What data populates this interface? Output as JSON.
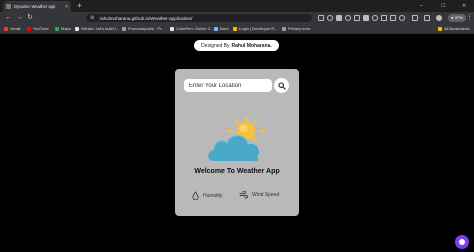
{
  "browser": {
    "tab_title": "Dynamic Weather app",
    "tab_close": "×",
    "new_tab": "+",
    "url": "rahulmoharana.github.io/Weather-application/",
    "profile_label": "● VPN",
    "window_controls": {
      "minimize": "–",
      "maximize": "☐",
      "close": "✕"
    },
    "menu": "⋮",
    "bookmarks": [
      {
        "label": "Gmail",
        "color": "#ea4335"
      },
      {
        "label": "YouTube",
        "color": "#ff0000"
      },
      {
        "label": "Maps",
        "color": "#34a853"
      },
      {
        "label": "GitHub: Let's build f...",
        "color": "#e6e6e6"
      },
      {
        "label": "Promonepubls · Pr...",
        "color": "#9aa0a6"
      },
      {
        "label": "CodePen: Online C...",
        "color": "#e6e6e6"
      },
      {
        "label": "Bard",
        "color": "#8ab4f8"
      },
      {
        "label": "Login | Developer R...",
        "color": "#fbbc04"
      },
      {
        "label": "Privacy error",
        "color": "#9aa0a6"
      }
    ],
    "all_bookmarks": "All Bookmarks"
  },
  "credit": {
    "prefix": "Designed By",
    "name": "Rahul Moharana."
  },
  "weather": {
    "search_placeholder": "Enter Your Location",
    "search_value": "",
    "welcome": "Welcome To Weather App",
    "humidity_label": "Humidity",
    "wind_label": "Wind Speed"
  },
  "colors": {
    "card_bg": "#b9b9b9",
    "cloud": "#4aa8c9",
    "sun": "#f6c23a",
    "fab": "#7b3ff2"
  }
}
